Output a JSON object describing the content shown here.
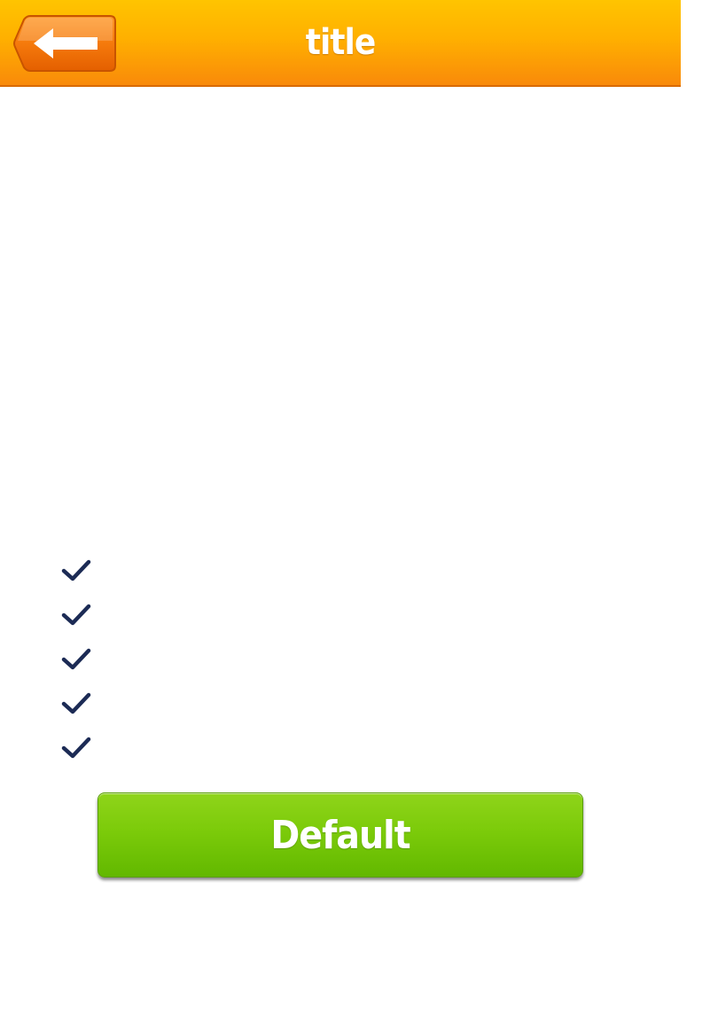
{
  "header": {
    "title": "title",
    "back_button_icon": "back-arrow-icon"
  },
  "checklist": {
    "items": [
      {
        "icon": "checkmark-icon",
        "label": ""
      },
      {
        "icon": "checkmark-icon",
        "label": ""
      },
      {
        "icon": "checkmark-icon",
        "label": ""
      },
      {
        "icon": "checkmark-icon",
        "label": ""
      },
      {
        "icon": "checkmark-icon",
        "label": ""
      }
    ]
  },
  "actions": {
    "default_label": "Default"
  },
  "colors": {
    "header_top": "#ffc400",
    "header_bottom": "#f98a0a",
    "back_button": "#f26a00",
    "check": "#1c2b55",
    "button_green": "#7ccb0a"
  }
}
